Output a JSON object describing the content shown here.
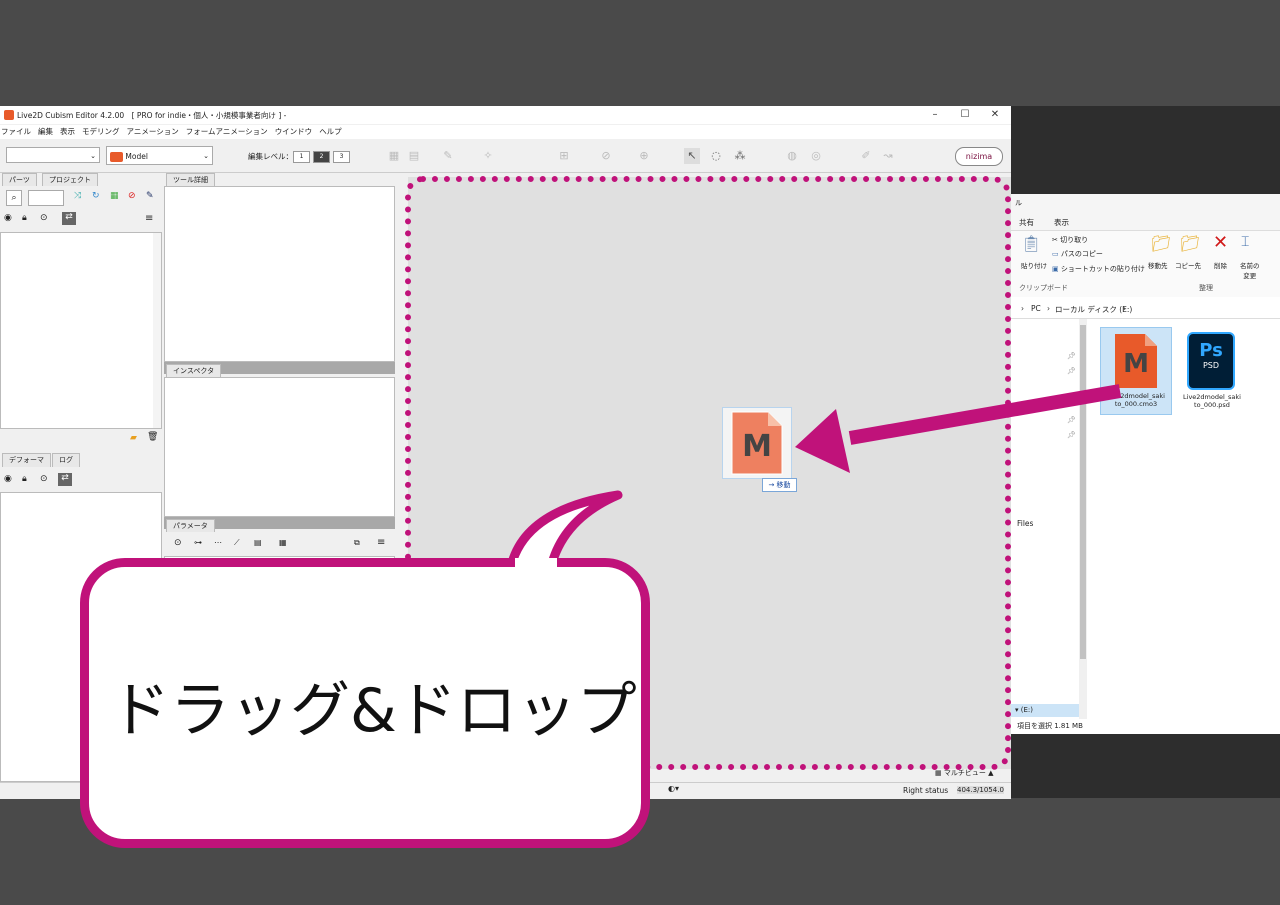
{
  "window": {
    "title": "Live2D Cubism Editor 4.2.00　[ PRO for indie・個人・小規模事業者向け ] -",
    "controls": [
      "–",
      "☐",
      "✕"
    ]
  },
  "menu": [
    "ファイル",
    "編集",
    "表示",
    "モデリング",
    "アニメーション",
    "フォームアニメーション",
    "ウインドウ",
    "ヘルプ"
  ],
  "toolbar": {
    "model_select": "Model",
    "edit_level_label": "編集レベル：",
    "levels": [
      "1",
      "2",
      "3"
    ],
    "brand_button": "nizima"
  },
  "panels": {
    "parts_tabs": [
      "パーツ",
      "プロジェクト"
    ],
    "tool_detail_tab": "ツール詳細",
    "inspector_tab": "インスペクタ",
    "deformer_tabs": [
      "デフォーマ",
      "ログ"
    ],
    "parameter_tab": "パラメータ"
  },
  "status": {
    "right_status": "Right status",
    "coords": "404.3/1054.0",
    "multi_view": "マルチビュー"
  },
  "explorer": {
    "title_fragment": "ル",
    "ribbon_tabs": [
      "共有",
      "表示"
    ],
    "clipboard": {
      "paste": "貼り付け",
      "cut": "切り取り",
      "copy_path": "パスのコピー",
      "paste_shortcut": "ショートカットの貼り付け",
      "group_label": "クリップボード"
    },
    "organize": {
      "move_to": "移動先",
      "copy_to": "コピー先",
      "delete": "削除",
      "rename_line1": "名前の",
      "rename_line2": "変更",
      "group_label": "整理"
    },
    "breadcrumb": [
      "PC",
      "ローカル ディスク (E:)"
    ],
    "sidebar_items": [
      "Files",
      "(E:)"
    ],
    "files": [
      {
        "name_line1": "Live2dmodel_saki",
        "name_line2": "to_000.cmo3",
        "icon": "cmo3-file-icon"
      },
      {
        "name_line1": "Live2dmodel_saki",
        "name_line2": "to_000.psd",
        "icon": "psd-file-icon",
        "badge": "Ps",
        "badge_sub": "PSD"
      }
    ],
    "status_text": "項目を選択  1.81 MB"
  },
  "drag": {
    "icon_letter": "M",
    "tooltip": "→ 移動"
  },
  "callout": {
    "text": "ドラッグ&ドロップ"
  },
  "colors": {
    "accent": "#c0127a",
    "cubism_orange": "#e85a2a",
    "ps_blue": "#001e36"
  }
}
